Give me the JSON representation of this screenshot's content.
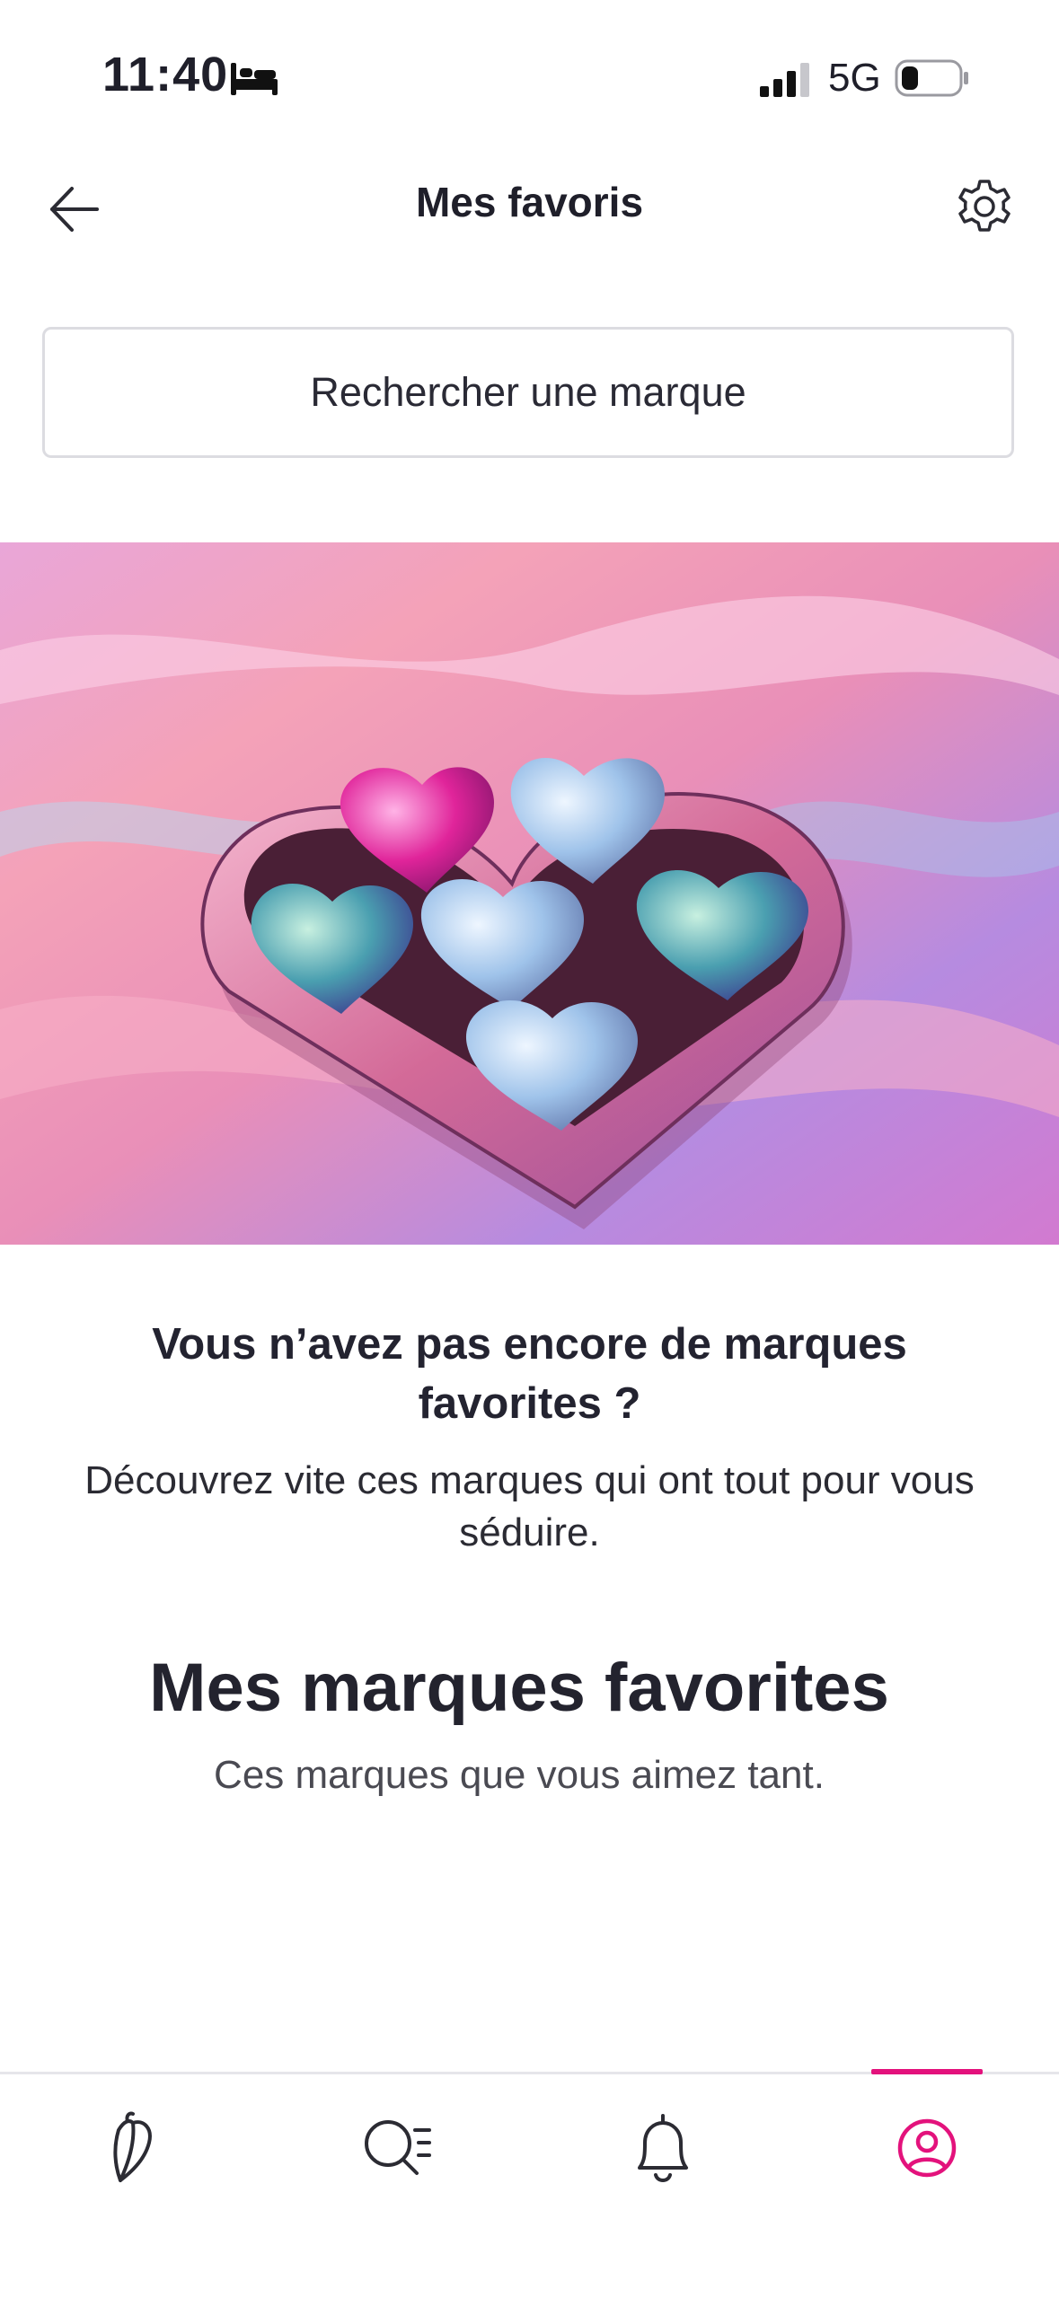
{
  "status_bar": {
    "time": "11:40",
    "network": "5G",
    "icons": [
      "bed-icon",
      "signal-icon",
      "battery-icon"
    ]
  },
  "header": {
    "title": "Mes favoris",
    "back_icon": "arrow-left-icon",
    "settings_icon": "gear-icon"
  },
  "search": {
    "label": "Rechercher une marque"
  },
  "hero": {
    "image": "heart-shaped box of foil-wrapped chocolates on iridescent background"
  },
  "empty_state": {
    "title": "Vous n’avez pas encore de marques favorites ?",
    "subtitle": "Découvrez vite ces marques qui ont tout pour vous séduire."
  },
  "favorites_section": {
    "title": "Mes marques favorites",
    "subtitle": "Ces marques que vous aimez tant."
  },
  "bottom_nav": {
    "items": [
      {
        "icon": "butterfly-home-icon",
        "active": false
      },
      {
        "icon": "search-list-icon",
        "active": false
      },
      {
        "icon": "bell-icon",
        "active": false
      },
      {
        "icon": "profile-icon",
        "active": true
      }
    ],
    "active_color": "#e3127c"
  }
}
